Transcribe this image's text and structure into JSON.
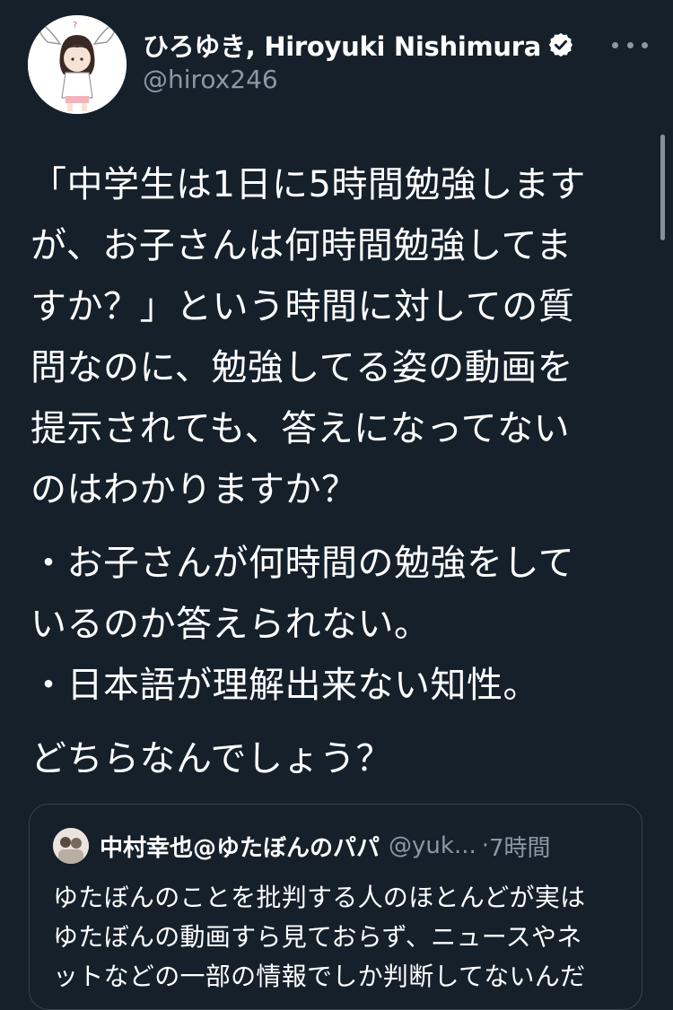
{
  "tweet": {
    "author": {
      "display_name": "ひろゆき, Hiroyuki Nishimura",
      "handle": "@hirox246",
      "verified": true,
      "avatar_icon": "avatar-illustration"
    },
    "more_icon": "more-dots-icon",
    "body_paragraphs": [
      [
        "「中学生は1日に5時間勉強します",
        "が、お子さんは何時間勉強してま",
        "すか？」という時間に対しての質",
        "問なのに、勉強してる姿の動画を",
        "提示されても、答えになってない",
        "のはわかりますか？"
      ],
      [
        "・お子さんが何時間の勉強をして",
        "いるのか答えられない。",
        "・日本語が理解出来ない知性。"
      ],
      [
        "どちらなんでしょう？"
      ]
    ]
  },
  "quoted_tweet": {
    "display_name": "中村幸也@ゆたぼんのパパ",
    "handle": "@yuk...",
    "separator": "·",
    "time": "7時間",
    "text_lines": [
      "ゆたぼんのことを批判する人のほとんどが実は",
      "ゆたぼんの動画すら見ておらず、ニュースやネ",
      "ットなどの一部の情報でしか判断してないんだ"
    ]
  },
  "colors": {
    "background": "#15202b",
    "text_primary": "#ffffff",
    "text_secondary": "#8b98a5",
    "border": "#38444d",
    "verified_badge": "#ffffff"
  }
}
